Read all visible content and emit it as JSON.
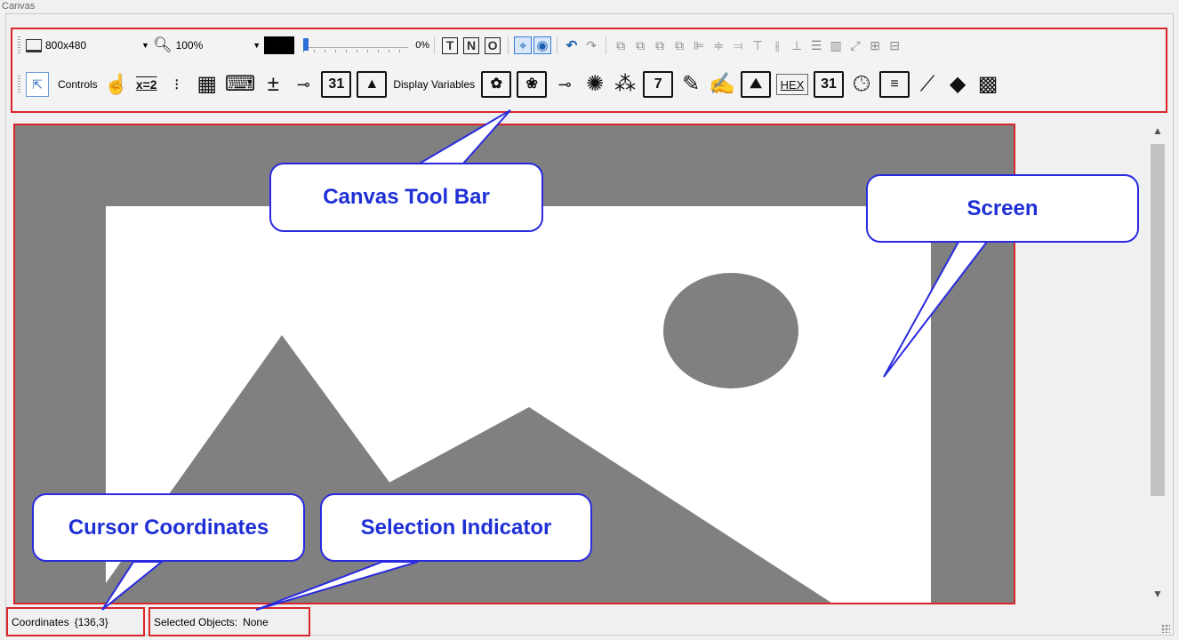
{
  "panel": {
    "title": "Canvas"
  },
  "toolbar": {
    "screen_size": "800x480",
    "zoom": "100%",
    "color_hex": "#000000",
    "transparency_pct": 0,
    "transparency_label": "0%",
    "text_buttons": [
      "T",
      "N",
      "O"
    ],
    "controls_label": "Controls",
    "display_variables_label": "Display Variables",
    "x2_label": "x=2",
    "cal_day": "31",
    "seven_label": "7",
    "hex_label": "HEX",
    "cal_day2": "31",
    "icons_row1": [
      "screen-size-icon",
      "zoom-icon",
      "crosshair-icon",
      "eye-icon",
      "undo-icon",
      "redo-icon",
      "bring-forward-icon",
      "send-backward-icon",
      "bring-to-front-icon",
      "send-to-back-icon",
      "align-left-icon",
      "align-center-icon",
      "align-right-icon",
      "align-top-icon",
      "align-middle-icon",
      "align-bottom-icon",
      "distribute-horizontal-icon",
      "distribute-vertical-icon",
      "same-size-icon",
      "group-icon",
      "ungroup-icon"
    ],
    "icons_row2": [
      "pointer-icon",
      "touch-icon",
      "traffic-light-icon",
      "keypad-icon",
      "keyboard-icon",
      "plus-minus-icon",
      "slider-icon",
      "calendar-icon",
      "alert-icon",
      "image-button-icon",
      "image-toggle-icon",
      "knob-icon",
      "numeric-icon",
      "seven-segment-icon",
      "numeric-display-icon",
      "text-display-icon",
      "image-icon",
      "hex-display-icon",
      "date-icon",
      "clock-icon",
      "list-icon",
      "trend-icon",
      "shapes-icon",
      "qr-code-icon"
    ]
  },
  "callouts": {
    "toolbar": "Canvas Tool Bar",
    "screen": "Screen",
    "cursor": "Cursor Coordinates",
    "selection": "Selection Indicator"
  },
  "status": {
    "coordinates_label": "Coordinates",
    "coordinates_value": "{136,3}",
    "selected_label": "Selected Objects:",
    "selected_value": "None"
  },
  "colors": {
    "highlight_border": "#d9262b",
    "callout_text": "#1e2fd6",
    "screen_gray": "#808080"
  }
}
